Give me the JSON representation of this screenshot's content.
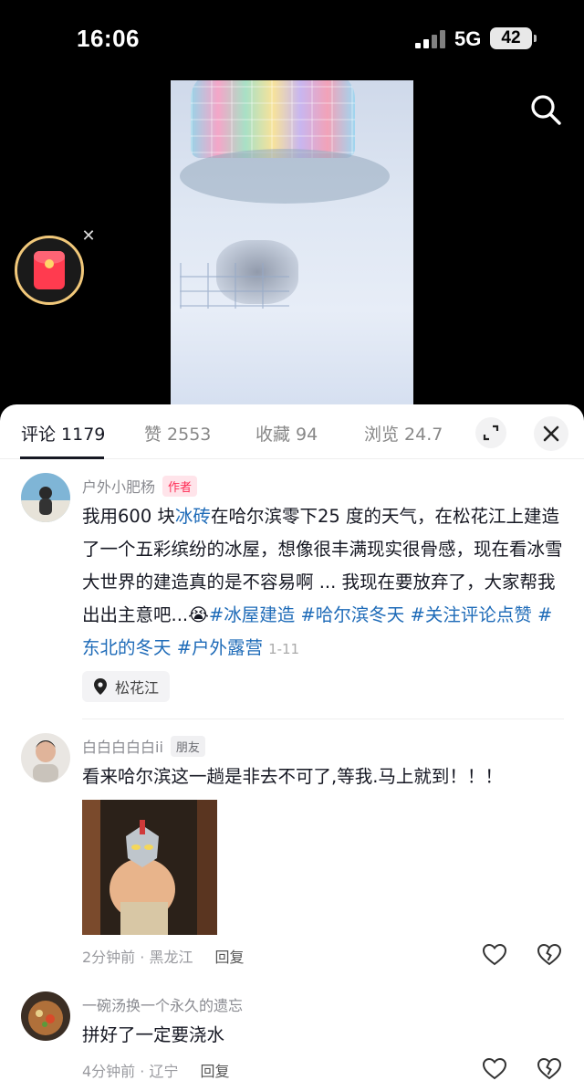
{
  "status": {
    "time": "16:06",
    "network": "5G",
    "battery": "42"
  },
  "tabs": [
    {
      "label": "评论 1179",
      "active": true
    },
    {
      "label": "赞 2553",
      "active": false
    },
    {
      "label": "收藏 94",
      "active": false
    },
    {
      "label": "浏览 24.7",
      "active": false
    }
  ],
  "comments": [
    {
      "name": "户外小肥杨",
      "badge": "作者",
      "text_before_link": "我用600 块",
      "link": "冰砖",
      "text_after_link": "在哈尔滨零下25 度的天气，在松花江上建造了一个五彩缤纷的冰屋，想像很丰满现实很骨感，现在看冰雪大世界的建造真的是不容易啊 ... 我现在要放弃了，大家帮我出出主意吧...😭",
      "tags": [
        "#冰屋建造",
        "#哈尔滨冬天",
        "#关注评论点赞",
        "#东北的冬天",
        "#户外露营"
      ],
      "date": "1-11",
      "location": "松花江"
    },
    {
      "name": "白白白白白ii",
      "badge": "朋友",
      "text": "看来哈尔滨这一趟是非去不可了,等我.马上就到！！！",
      "time": "2分钟前 · 黑龙江",
      "reply": "回复"
    },
    {
      "name": "一碗汤换一个永久的遗忘",
      "text": "拼好了一定要浇水",
      "time": "4分钟前 · 辽宁",
      "reply": "回复"
    }
  ],
  "colors": {
    "accent": "#fe2c55",
    "link": "#1e6bb8",
    "redpacket": "#ff3b4f"
  }
}
